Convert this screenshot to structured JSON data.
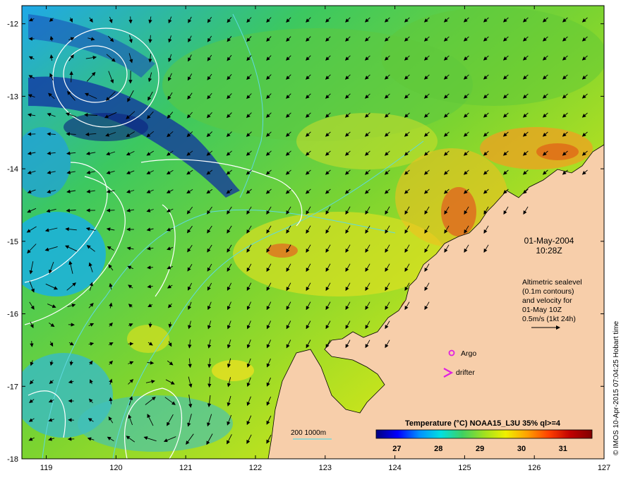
{
  "map": {
    "lon_ticks": [
      "119",
      "120",
      "121",
      "122",
      "123",
      "124",
      "125",
      "126",
      "127"
    ],
    "lat_ticks": [
      "-12",
      "-13",
      "-14",
      "-15",
      "-16",
      "-17",
      "-18"
    ],
    "lon_range": [
      118.65,
      127.0
    ],
    "lat_range": [
      -11.75,
      -18.0
    ],
    "land_color": "#f7ceaa",
    "contour_color": "#ffffff",
    "bathymetry_color": "#5fd9e0",
    "arrow_color": "#000000"
  },
  "date_label": {
    "date": "01-May-2004",
    "time": "10:28Z"
  },
  "altimetry_note": {
    "line1": "Altimetric sealevel",
    "line2": "(0.1m contours)",
    "line3": "and velocity for",
    "line4": "01-May 10Z",
    "line5": "0.5m/s (1kt 24h)"
  },
  "markers": {
    "argo_label": "Argo",
    "argo_color": "#e020e0",
    "drifter_label": "drifter",
    "drifter_color": "#e020e0"
  },
  "bathy_legend": {
    "label": "200  1000m"
  },
  "colorbar": {
    "title": "Temperature (°C) NOAA15_L3U 35% ql>=4",
    "ticks": [
      "27",
      "28",
      "29",
      "30",
      "31"
    ],
    "range": [
      26.5,
      31.7
    ],
    "stops": [
      "#00007f",
      "#0000ff",
      "#0090ff",
      "#00e0e0",
      "#40d060",
      "#a0e020",
      "#f0f000",
      "#ffa000",
      "#ff4000",
      "#c00000",
      "#800000"
    ]
  },
  "credit": "© IMOS 10-Apr-2015 07:04:25 Hobart time"
}
